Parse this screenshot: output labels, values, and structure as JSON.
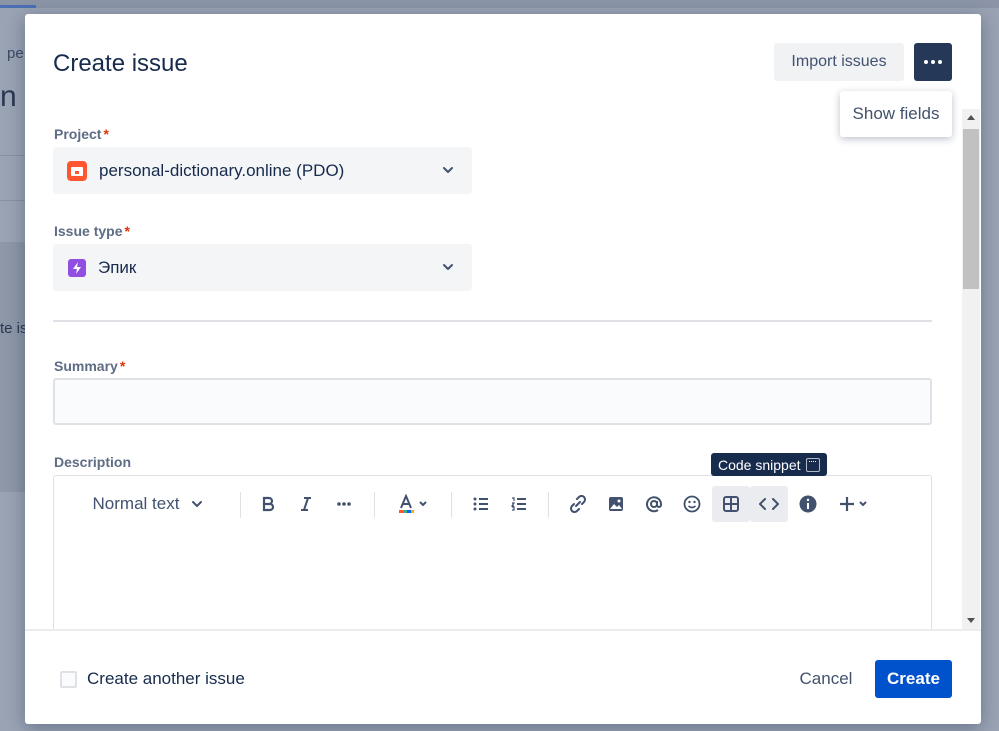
{
  "background": {
    "crumb_text": "pe",
    "big_text": "n P",
    "side_text": "te is"
  },
  "modal": {
    "title": "Create issue",
    "import_button": "Import issues",
    "more_icon": "more-horizontal-icon",
    "popover_label": "Show fields",
    "fields": {
      "project": {
        "label": "Project",
        "required_mark": "*",
        "value": "personal-dictionary.online (PDO)",
        "icon": "project-avatar-icon"
      },
      "issue_type": {
        "label": "Issue type",
        "required_mark": "*",
        "value": "Эпик",
        "icon": "epic-icon"
      },
      "summary": {
        "label": "Summary",
        "required_mark": "*",
        "value": ""
      },
      "description": {
        "label": "Description",
        "toolbar": {
          "text_style": "Normal text",
          "tooltip": "Code snippet"
        }
      }
    },
    "footer": {
      "checkbox_label": "Create another issue",
      "checkbox_checked": false,
      "cancel_button": "Cancel",
      "create_button": "Create"
    },
    "colors": {
      "primary": "#0052cc",
      "more_button_bg": "#253858",
      "required": "#de350b",
      "epic": "#904ee2",
      "project_icon": "#ff5630"
    }
  }
}
